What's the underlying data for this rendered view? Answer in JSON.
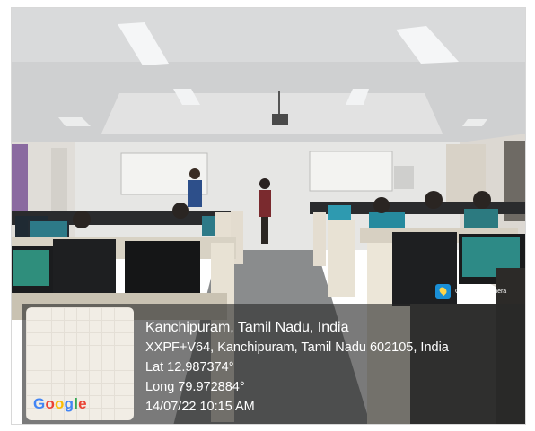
{
  "badge": {
    "label": "GPS Map Camera",
    "icon": "gps-map-camera-icon"
  },
  "location": {
    "place": "Kanchipuram, Tamil Nadu, India",
    "address": "XXPF+V64, Kanchipuram, Tamil Nadu 602105, India",
    "lat": "Lat 12.987374°",
    "long": "Long 79.972884°",
    "timestamp": "14/07/22 10:15 AM"
  },
  "map": {
    "brand": "Google"
  },
  "colors": {
    "google_blue": "#4285f4",
    "google_red": "#ea4335",
    "google_yellow": "#fbbc05",
    "google_green": "#34a853"
  }
}
